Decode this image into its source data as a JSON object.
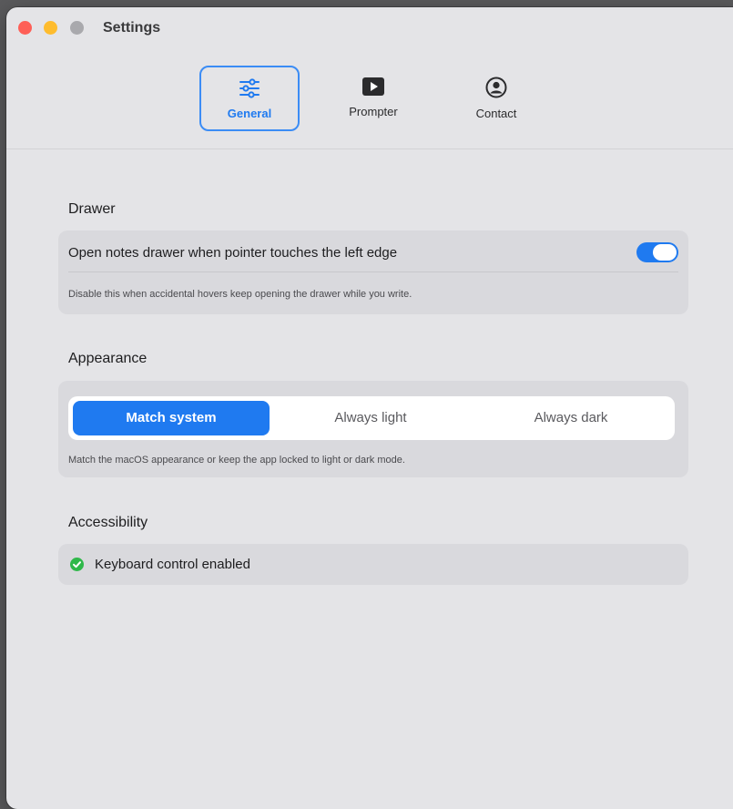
{
  "window": {
    "title": "Settings"
  },
  "tabs": [
    {
      "label": "General",
      "icon": "sliders-icon",
      "active": true
    },
    {
      "label": "Prompter",
      "icon": "play-icon",
      "active": false
    },
    {
      "label": "Contact",
      "icon": "person-circle-icon",
      "active": false
    }
  ],
  "drawer": {
    "title": "Drawer",
    "toggle_label": "Open notes drawer when pointer touches the left edge",
    "toggle_on": true,
    "helper": "Disable this when accidental hovers keep opening the drawer while you write."
  },
  "appearance": {
    "title": "Appearance",
    "options": [
      "Match system",
      "Always light",
      "Always dark"
    ],
    "selected": "Match system",
    "helper": "Match the macOS appearance or keep the app locked to light or dark mode."
  },
  "accessibility": {
    "title": "Accessibility",
    "status": "Keyboard control enabled"
  },
  "colors": {
    "accent": "#1f7af0",
    "window_bg": "#e4e4e7",
    "card_bg": "#d9d9dd",
    "success": "#2fb84a"
  }
}
